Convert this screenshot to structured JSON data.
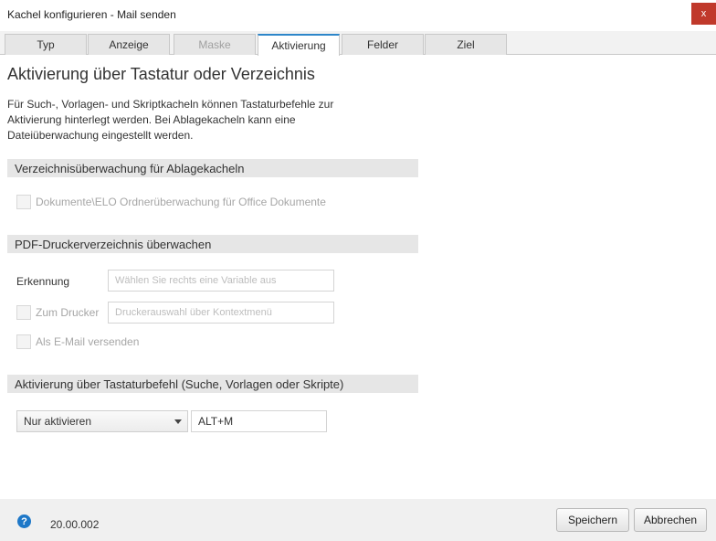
{
  "window": {
    "title": "Kachel konfigurieren - Mail senden",
    "close_label": "x"
  },
  "tabs": [
    {
      "label": "Typ"
    },
    {
      "label": "Anzeige"
    },
    {
      "label": "Maske"
    },
    {
      "label": "Aktivierung"
    },
    {
      "label": "Felder"
    },
    {
      "label": "Ziel"
    }
  ],
  "main": {
    "heading": "Aktivierung über Tastatur oder Verzeichnis",
    "description": "Für Such-, Vorlagen- und Skriptkacheln können Tastaturbefehle zur Aktivierung hinterlegt werden. Bei Ablagekacheln kann eine Dateiüberwachung eingestellt werden."
  },
  "section_folder": {
    "title": "Verzeichnisüberwachung für Ablagekacheln",
    "checkbox_label": "Dokumente\\ELO Ordnerüberwachung für Office Dokumente"
  },
  "section_pdf": {
    "title": "PDF-Druckerverzeichnis überwachen",
    "recognition_label": "Erkennung",
    "recognition_placeholder": "Wählen Sie rechts eine Variable aus",
    "printer_label": "Zum Drucker",
    "printer_placeholder": "Druckerauswahl über Kontextmenü",
    "email_label": "Als E-Mail versenden"
  },
  "section_keyboard": {
    "title": "Aktivierung über Tastaturbefehl (Suche, Vorlagen oder Skripte)",
    "mode_selected": "Nur aktivieren",
    "shortcut_value": "ALT+M"
  },
  "footer": {
    "help_symbol": "?",
    "version": "20.00.002",
    "save_label": "Speichern",
    "cancel_label": "Abbrechen"
  }
}
